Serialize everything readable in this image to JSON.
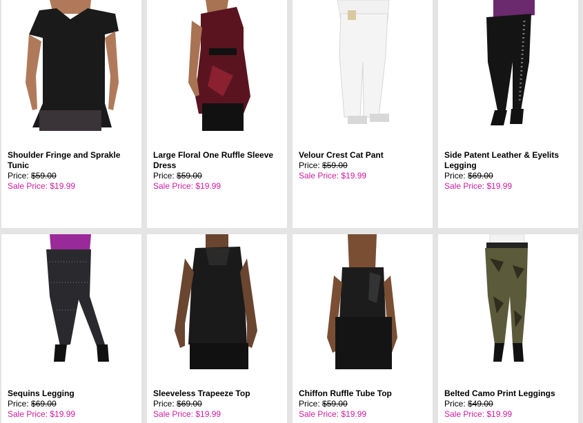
{
  "labels": {
    "price": "Price:",
    "sale": "Sale Price:"
  },
  "products": [
    {
      "name": "Shoulder Fringe and Sprakle Tunic",
      "price": "$59.00",
      "sale": "$19.99",
      "icon": "black-tunic-photo"
    },
    {
      "name": "Large Floral One Ruffle Sleeve Dress",
      "price": "$59.00",
      "sale": "$19.99",
      "icon": "floral-dress-photo"
    },
    {
      "name": "Velour Crest Cat Pant",
      "price": "$59.00",
      "sale": "$19.99",
      "icon": "white-pant-photo"
    },
    {
      "name": "Side Patent Leather & Eyelits Legging",
      "price": "$69.00",
      "sale": "$19.99",
      "icon": "black-legging-photo"
    },
    {
      "name": "Sequins Legging",
      "price": "$69.00",
      "sale": "$19.99",
      "icon": "sequin-legging-photo"
    },
    {
      "name": "Sleeveless Trapeeze Top",
      "price": "$69.00",
      "sale": "$19.99",
      "icon": "black-top-photo"
    },
    {
      "name": "Chiffon Ruffle Tube Top",
      "price": "$59.00",
      "sale": "$19.99",
      "icon": "tube-top-photo"
    },
    {
      "name": "Belted Camo Print Leggings",
      "price": "$49.00",
      "sale": "$19.99",
      "icon": "camo-legging-photo"
    }
  ],
  "colors": {
    "sale": "#cc1a9e",
    "background": "#e4e4e4"
  }
}
